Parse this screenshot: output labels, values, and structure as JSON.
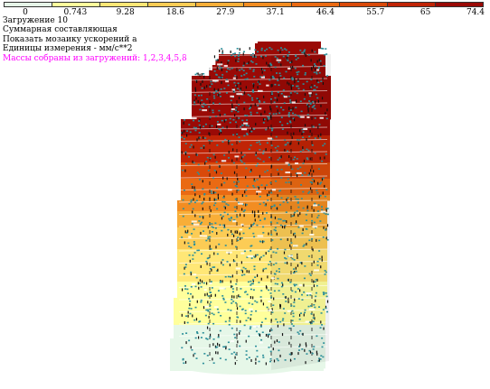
{
  "legend": {
    "ticks": [
      "0",
      "0.743",
      "9.28",
      "18.6",
      "27.9",
      "37.1",
      "46.4",
      "55.7",
      "65",
      "74.4"
    ],
    "colors": [
      "#e6f7e8",
      "#ffff9c",
      "#ffe776",
      "#fccc55",
      "#f8ae38",
      "#f28d22",
      "#ea6a13",
      "#d94a0a",
      "#c02406",
      "#9a0a06"
    ]
  },
  "info": {
    "line1": "Загружение 10",
    "line2": "Суммарная составляющая",
    "line3": "Показать мозаику ускорений a",
    "line4": "Единицы измерения - мм/с**2",
    "line5": "Массы собраны из загружений:  1,2,3,4,5,8"
  },
  "colors": {
    "magenta": "#ff00ff",
    "node_marks": "#2c8f9a",
    "edge_marks": "#111111",
    "base_fill": "#e6f7e8"
  }
}
